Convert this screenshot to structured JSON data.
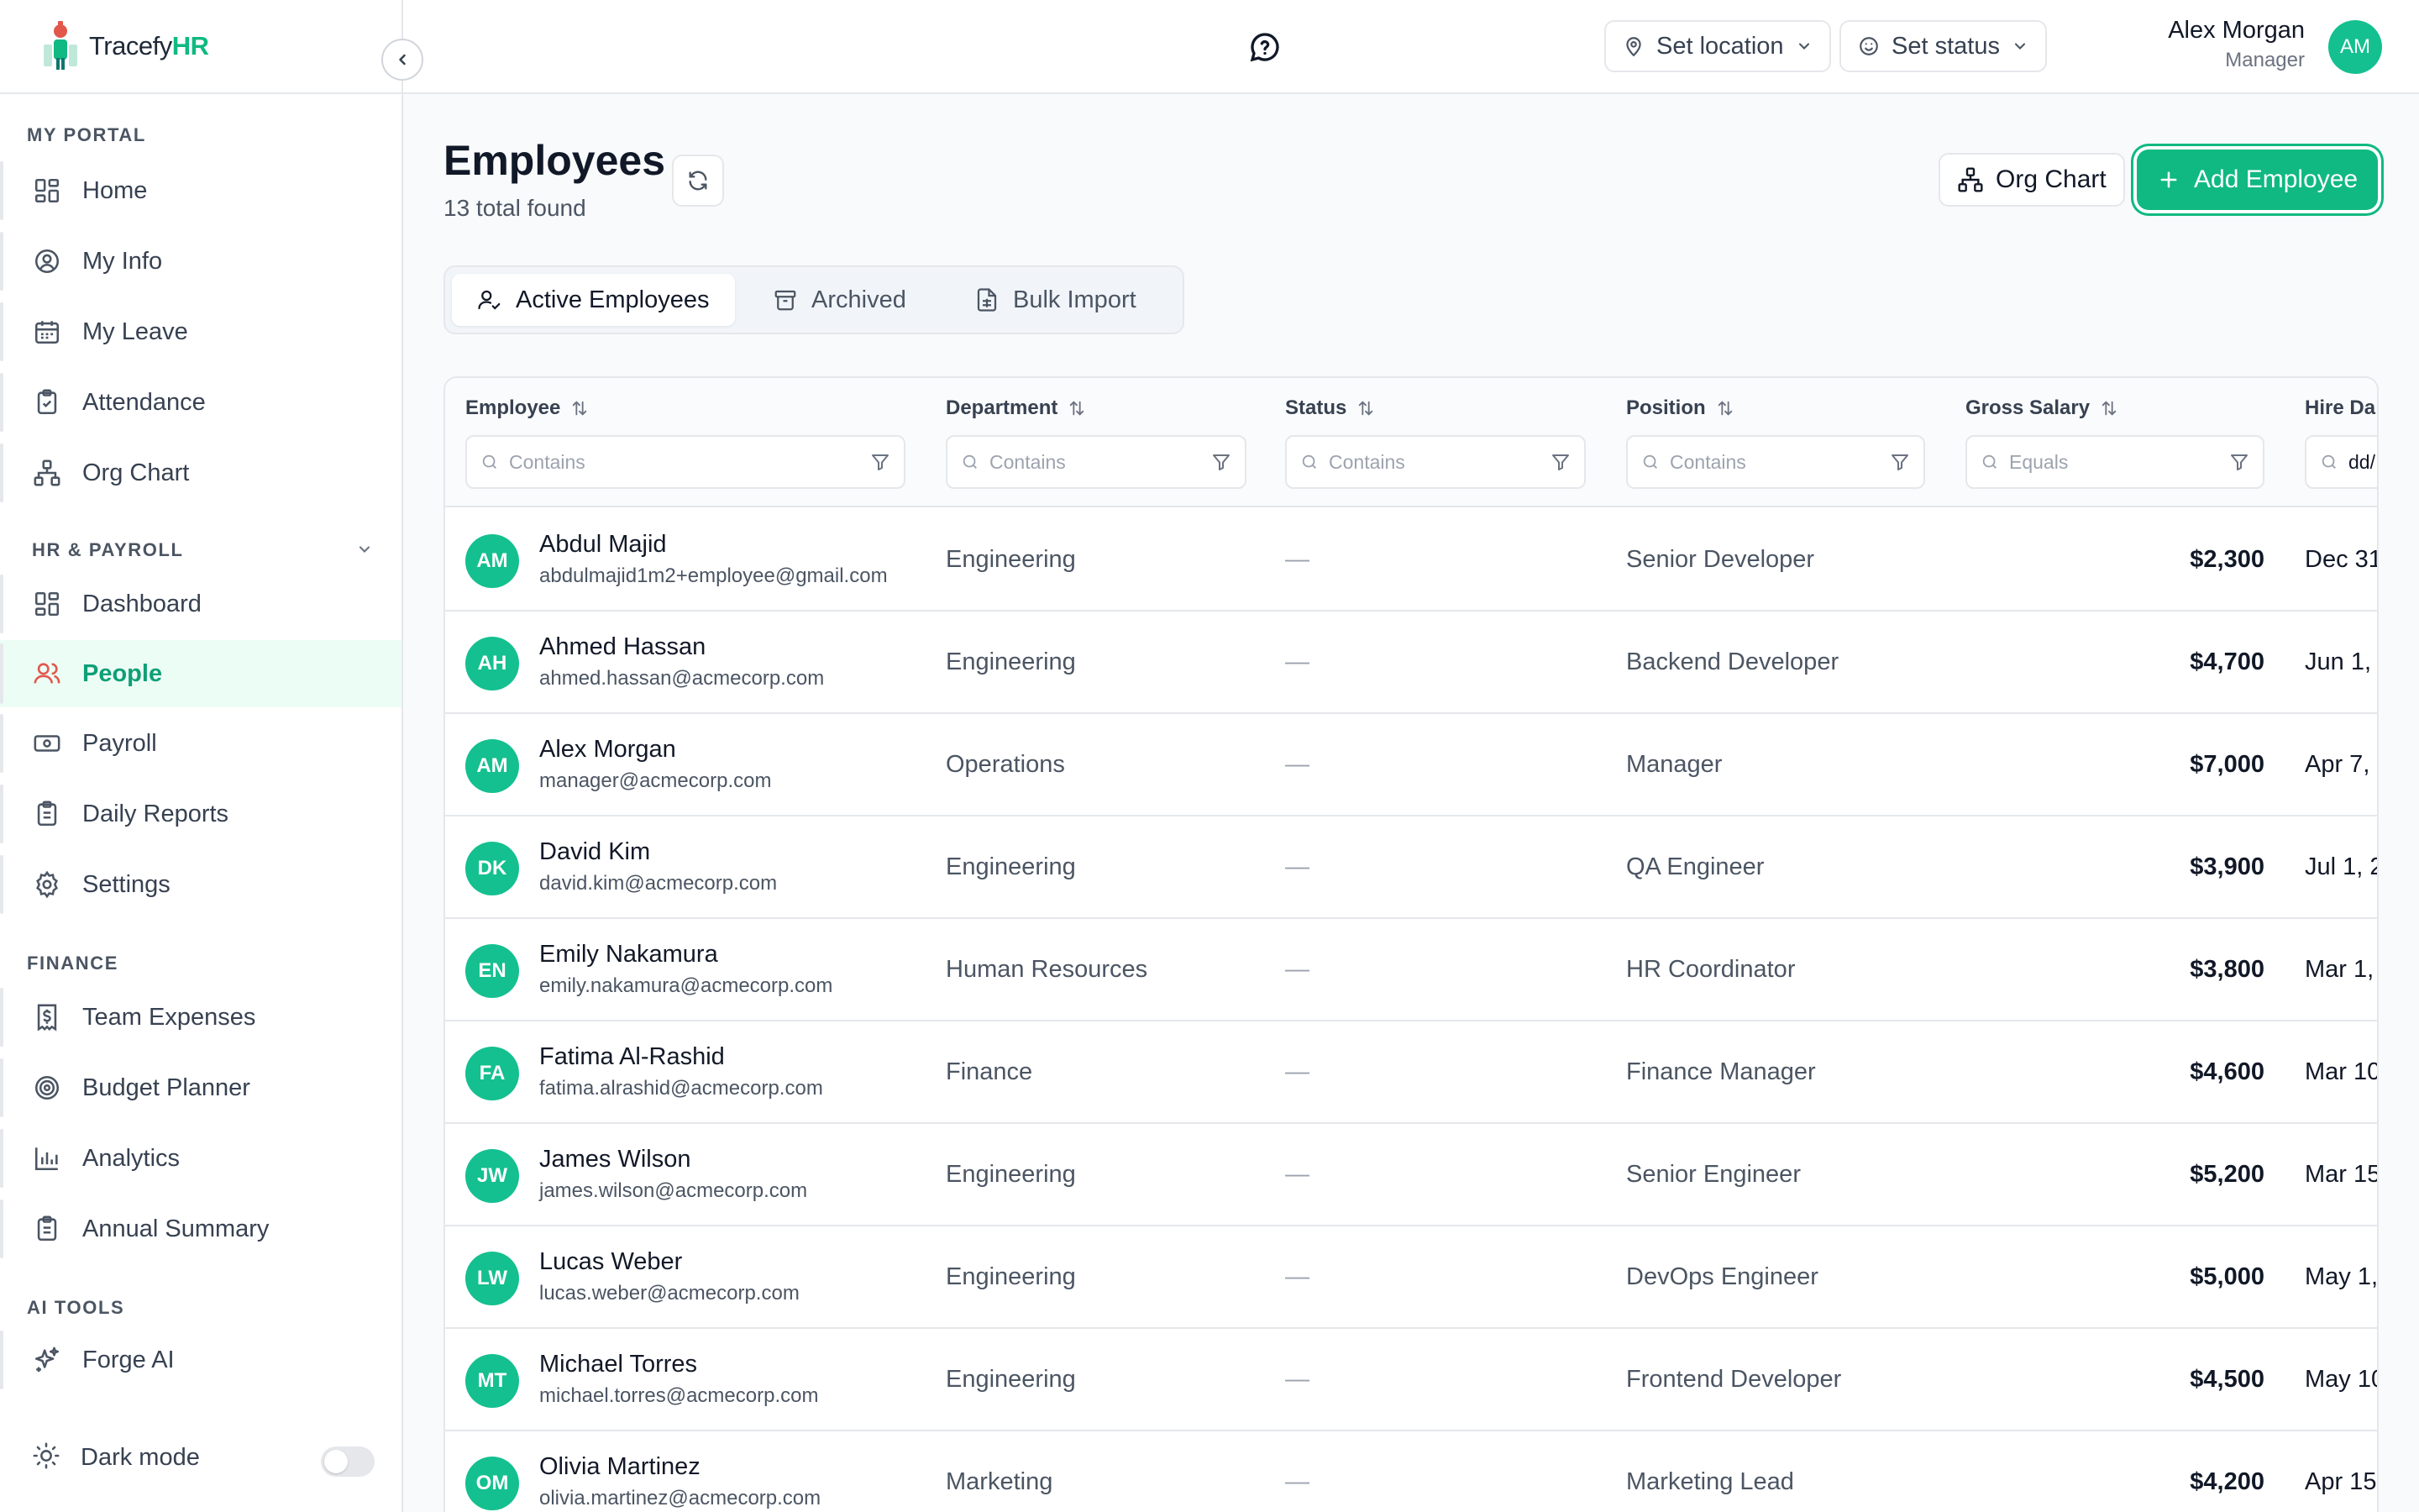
{
  "brand": {
    "name_prefix": "Tracefy",
    "name_suffix": "HR",
    "accent": "#10b981"
  },
  "sidebar": {
    "sections": [
      {
        "label": "MY PORTAL"
      },
      {
        "label": "HR & PAYROLL"
      },
      {
        "label": "FINANCE"
      },
      {
        "label": "AI TOOLS"
      }
    ],
    "items": [
      {
        "label": "Home",
        "icon": "grid-icon"
      },
      {
        "label": "My Info",
        "icon": "user-circle-icon"
      },
      {
        "label": "My Leave",
        "icon": "calendar-icon"
      },
      {
        "label": "Attendance",
        "icon": "clipboard-check-icon"
      },
      {
        "label": "Org Chart",
        "icon": "org-chart-icon"
      },
      {
        "label": "Dashboard",
        "icon": "grid-icon"
      },
      {
        "label": "People",
        "icon": "users-icon",
        "active": true
      },
      {
        "label": "Payroll",
        "icon": "banknote-icon"
      },
      {
        "label": "Daily Reports",
        "icon": "clipboard-list-icon"
      },
      {
        "label": "Settings",
        "icon": "gear-icon"
      },
      {
        "label": "Team Expenses",
        "icon": "receipt-dollar-icon"
      },
      {
        "label": "Budget Planner",
        "icon": "target-icon"
      },
      {
        "label": "Analytics",
        "icon": "bar-chart-icon"
      },
      {
        "label": "Annual Summary",
        "icon": "clipboard-list-icon"
      },
      {
        "label": "Forge AI",
        "icon": "sparkles-icon"
      }
    ],
    "dark_mode_label": "Dark mode",
    "dark_mode_on": false
  },
  "topbar": {
    "location_label": "Set location",
    "status_label": "Set status",
    "user": {
      "name": "Alex Morgan",
      "role": "Manager",
      "initials": "AM"
    }
  },
  "page": {
    "title": "Employees",
    "subtitle": "13 total found",
    "org_chart_label": "Org Chart",
    "add_label": "Add Employee"
  },
  "tabs": [
    {
      "label": "Active Employees",
      "active": true
    },
    {
      "label": "Archived"
    },
    {
      "label": "Bulk Import"
    }
  ],
  "table": {
    "columns": [
      {
        "label": "Employee",
        "filter": "Contains"
      },
      {
        "label": "Department",
        "filter": "Contains"
      },
      {
        "label": "Status",
        "filter": "Contains"
      },
      {
        "label": "Position",
        "filter": "Contains"
      },
      {
        "label": "Gross Salary",
        "filter": "Equals"
      },
      {
        "label": "Hire Da",
        "filter": "dd/"
      }
    ],
    "rows": [
      {
        "initials": "AM",
        "name": "Abdul Majid",
        "email": "abdulmajid1m2+employee@gmail.com",
        "department": "Engineering",
        "status": "—",
        "position": "Senior Developer",
        "salary": "$2,300",
        "hire": "Dec 31"
      },
      {
        "initials": "AH",
        "name": "Ahmed Hassan",
        "email": "ahmed.hassan@acmecorp.com",
        "department": "Engineering",
        "status": "—",
        "position": "Backend Developer",
        "salary": "$4,700",
        "hire": "Jun 1, 2"
      },
      {
        "initials": "AM",
        "name": "Alex Morgan",
        "email": "manager@acmecorp.com",
        "department": "Operations",
        "status": "—",
        "position": "Manager",
        "salary": "$7,000",
        "hire": "Apr 7, 2"
      },
      {
        "initials": "DK",
        "name": "David Kim",
        "email": "david.kim@acmecorp.com",
        "department": "Engineering",
        "status": "—",
        "position": "QA Engineer",
        "salary": "$3,900",
        "hire": "Jul 1, 2"
      },
      {
        "initials": "EN",
        "name": "Emily Nakamura",
        "email": "emily.nakamura@acmecorp.com",
        "department": "Human Resources",
        "status": "—",
        "position": "HR Coordinator",
        "salary": "$3,800",
        "hire": "Mar 1,"
      },
      {
        "initials": "FA",
        "name": "Fatima Al-Rashid",
        "email": "fatima.alrashid@acmecorp.com",
        "department": "Finance",
        "status": "—",
        "position": "Finance Manager",
        "salary": "$4,600",
        "hire": "Mar 10"
      },
      {
        "initials": "JW",
        "name": "James Wilson",
        "email": "james.wilson@acmecorp.com",
        "department": "Engineering",
        "status": "—",
        "position": "Senior Engineer",
        "salary": "$5,200",
        "hire": "Mar 15"
      },
      {
        "initials": "LW",
        "name": "Lucas Weber",
        "email": "lucas.weber@acmecorp.com",
        "department": "Engineering",
        "status": "—",
        "position": "DevOps Engineer",
        "salary": "$5,000",
        "hire": "May 1,"
      },
      {
        "initials": "MT",
        "name": "Michael Torres",
        "email": "michael.torres@acmecorp.com",
        "department": "Engineering",
        "status": "—",
        "position": "Frontend Developer",
        "salary": "$4,500",
        "hire": "May 10"
      },
      {
        "initials": "OM",
        "name": "Olivia Martinez",
        "email": "olivia.martinez@acmecorp.com",
        "department": "Marketing",
        "status": "—",
        "position": "Marketing Lead",
        "salary": "$4,200",
        "hire": "Apr 15,"
      }
    ]
  }
}
